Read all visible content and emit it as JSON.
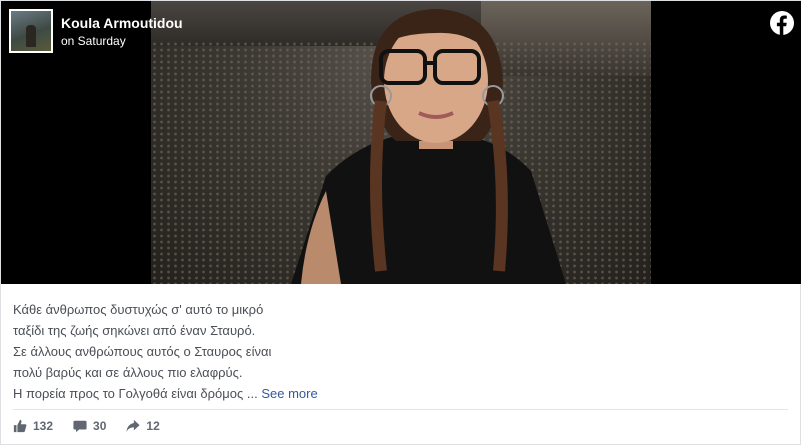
{
  "post": {
    "author": "Koula Armoutidou",
    "time": "on Saturday",
    "text_lines": [
      "Κάθε άνθρωπος δυστυχώς σ' αυτό το μικρό",
      "ταξίδι της ζωής σηκώνει από έναν Σταυρό.",
      "Σε άλλους ανθρώπους αυτός ο Σταυρος είναι",
      "πολύ βαρύς και σε άλλους πιο ελαφρύς.",
      "Η πορεία προς το Γολγοθά είναι δρόμος ..."
    ],
    "see_more": "See more"
  },
  "stats": {
    "likes": "132",
    "comments": "30",
    "shares": "12"
  },
  "icons": {
    "brand": "facebook-icon",
    "like": "thumbs-up-icon",
    "comment": "comment-icon",
    "share": "share-arrow-icon"
  },
  "colors": {
    "brand": "#1877f2",
    "link": "#365899",
    "text": "#4b4f56",
    "meta": "#606770"
  }
}
